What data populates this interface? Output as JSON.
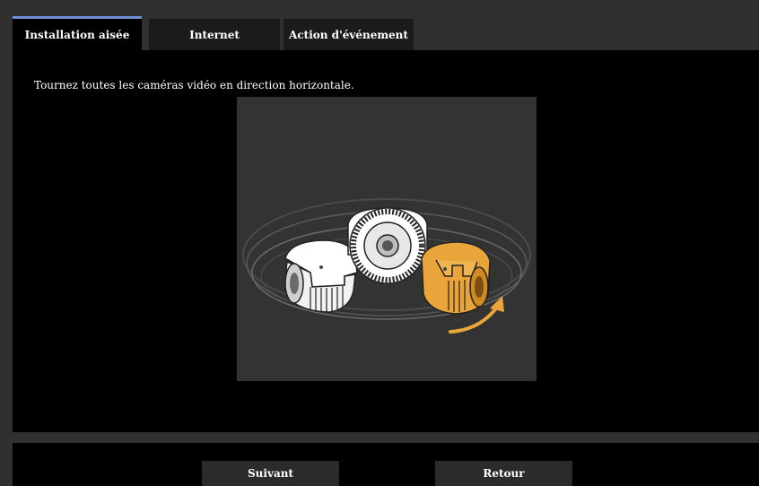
{
  "tabs": {
    "easy_setup": "Installation aisée",
    "internet": "Internet",
    "event_action": "Action d'événement"
  },
  "instruction": "Tournez toutes les caméras vidéo en direction horizontale.",
  "illustration": {
    "icon": "dome-cameras-rotation-icon",
    "highlight_color": "#e9a43a"
  },
  "buttons": {
    "next": "Suivant",
    "back": "Retour"
  },
  "colors": {
    "active_tab_accent": "#6e8ed8",
    "panel_bg": "#000000",
    "frame_bg": "#303030"
  }
}
